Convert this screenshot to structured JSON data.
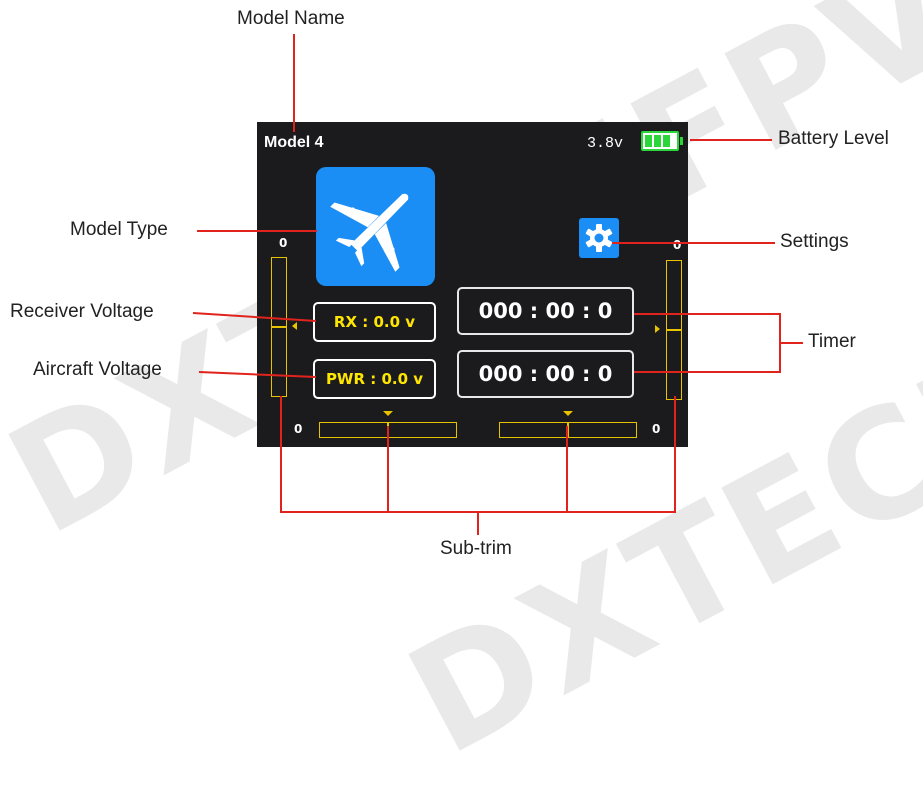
{
  "callouts": {
    "model_name": "Model Name",
    "battery_level": "Battery Level",
    "model_type": "Model Type",
    "settings": "Settings",
    "receiver_voltage": "Receiver Voltage",
    "aircraft_voltage": "Aircraft Voltage",
    "timer": "Timer",
    "sub_trim": "Sub-trim"
  },
  "screen": {
    "model_name": "Model 4",
    "tx_voltage": "3.8v",
    "battery": {
      "cells_filled": 3,
      "cells_total": 3
    },
    "model_type_icon": "airplane-icon",
    "settings_icon": "gear-icon",
    "rx_voltage": "RX : 0.0 v",
    "pwr_voltage": "PWR : 0.0 v",
    "timer_1": "000 : 00 : 0",
    "timer_2": "000 : 00 : 0",
    "trims": {
      "left_vertical_label": "0",
      "left_horizontal_label": "0",
      "right_vertical_label": "0",
      "right_horizontal_label": "0"
    }
  },
  "colors": {
    "screen_bg": "#1b1b1e",
    "accent_blue": "#1b8ef5",
    "trim_yellow": "#e8c400",
    "battery_green": "#2bd63a",
    "leader_red": "#e0231c"
  },
  "watermark": "DXTECHFPV."
}
